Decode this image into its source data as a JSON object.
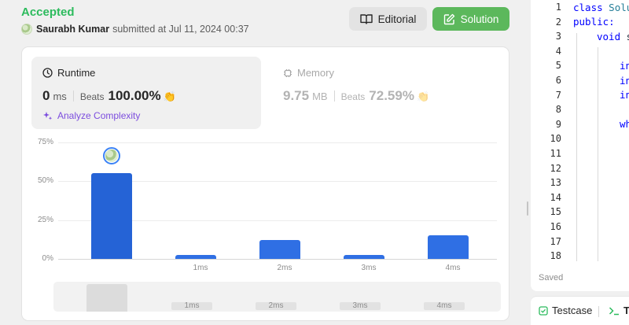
{
  "submission": {
    "status": "Accepted",
    "author": "Saurabh Kumar",
    "submitted_text": "submitted at Jul 11, 2024 00:37"
  },
  "buttons": {
    "editorial": "Editorial",
    "solution": "Solution"
  },
  "runtime": {
    "title": "Runtime",
    "value": "0",
    "unit": "ms",
    "beats_label": "Beats",
    "beats_value": "100.00%",
    "analyze": "Analyze Complexity"
  },
  "memory": {
    "title": "Memory",
    "value": "9.75",
    "unit": "MB",
    "beats_label": "Beats",
    "beats_value": "72.59%"
  },
  "chart_data": {
    "type": "bar",
    "categories": [
      "0ms",
      "1ms",
      "2ms",
      "3ms",
      "4ms"
    ],
    "x_tick_labels": [
      "",
      "1ms",
      "2ms",
      "3ms",
      "4ms"
    ],
    "values": [
      55,
      2.5,
      12,
      2.5,
      15
    ],
    "ylim": [
      0,
      75
    ],
    "y_ticks": [
      "75%",
      "50%",
      "25%",
      "0%"
    ],
    "highlight_index": 0,
    "bar_color": "#2f6fe4"
  },
  "editor": {
    "line_numbers": [
      "1",
      "2",
      "3",
      "4",
      "5",
      "6",
      "7",
      "8",
      "9",
      "10",
      "11",
      "12",
      "13",
      "14",
      "15",
      "16",
      "17",
      "18"
    ],
    "line1_kw": "class",
    "line1_name": "Solu",
    "line2": "public:",
    "line3_kw": "void",
    "line3_rest": "s",
    "line5": "in",
    "line6": "in",
    "line7": "in",
    "line9": "wh",
    "saved": "Saved"
  },
  "bottom_tabs": {
    "testcase": "Testcase",
    "test_result_initial": "T"
  },
  "colors": {
    "accepted": "#2cbb5d",
    "solution_button": "#5cb85c",
    "bar": "#2f6fe4",
    "analyze": "#7c4dde"
  }
}
